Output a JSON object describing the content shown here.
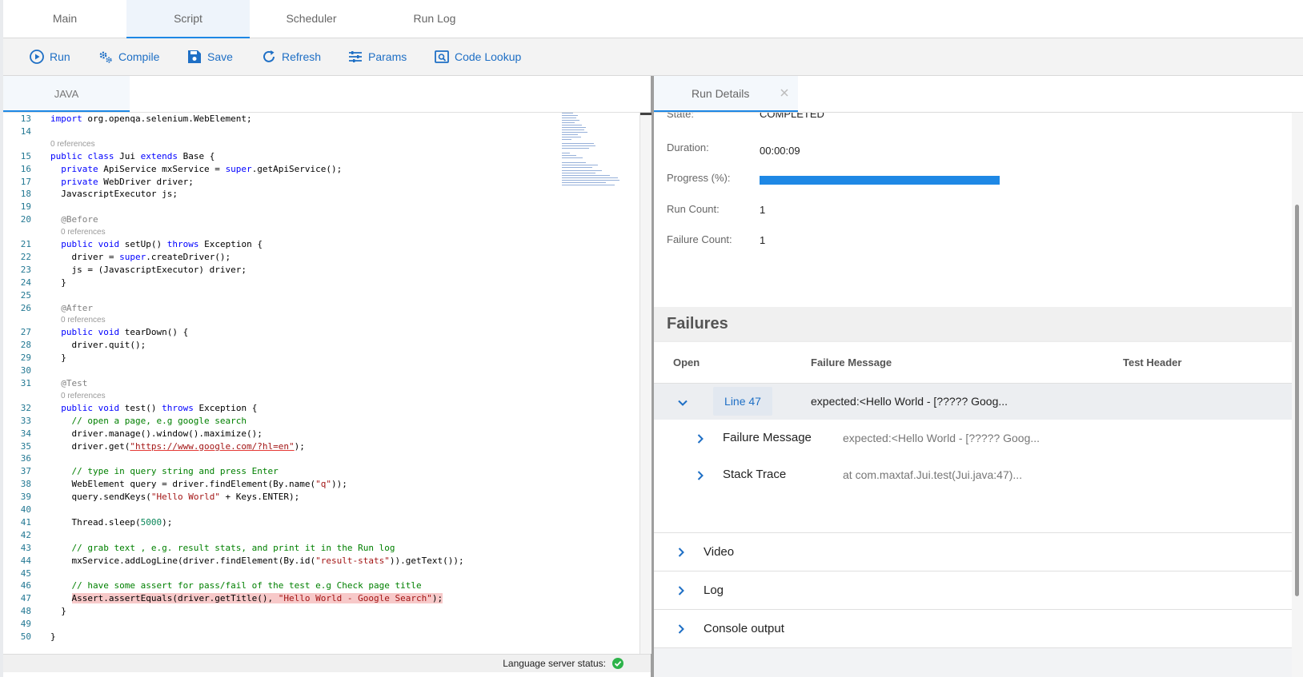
{
  "top_tabs": [
    "Main",
    "Script",
    "Scheduler",
    "Run Log"
  ],
  "active_top_tab": "Script",
  "toolbar": {
    "run": "Run",
    "compile": "Compile",
    "save": "Save",
    "refresh": "Refresh",
    "params": "Params",
    "code_lookup": "Code Lookup"
  },
  "colors": {
    "accent": "#1e88e5",
    "link": "#1e6fc5",
    "error_bg": "#f7c9c9",
    "ok": "#2db34a"
  },
  "editor": {
    "tab": "JAVA",
    "references_label": "0 references",
    "lines": [
      {
        "n": "13",
        "t": "import org.openqa.selenium.WebElement;"
      },
      {
        "n": "14",
        "t": ""
      },
      {
        "n": "15",
        "t": "public class Jui extends Base {"
      },
      {
        "n": "16",
        "t": "  private ApiService mxService = super.getApiService();"
      },
      {
        "n": "17",
        "t": "  private WebDriver driver;"
      },
      {
        "n": "18",
        "t": "  JavascriptExecutor js;"
      },
      {
        "n": "19",
        "t": ""
      },
      {
        "n": "20",
        "t": "  @Before"
      },
      {
        "n": "21",
        "t": "  public void setUp() throws Exception {"
      },
      {
        "n": "22",
        "t": "    driver = super.createDriver();"
      },
      {
        "n": "23",
        "t": "    js = (JavascriptExecutor) driver;"
      },
      {
        "n": "24",
        "t": "  }"
      },
      {
        "n": "25",
        "t": ""
      },
      {
        "n": "26",
        "t": "  @After"
      },
      {
        "n": "27",
        "t": "  public void tearDown() {"
      },
      {
        "n": "28",
        "t": "    driver.quit();"
      },
      {
        "n": "29",
        "t": "  }"
      },
      {
        "n": "30",
        "t": ""
      },
      {
        "n": "31",
        "t": "  @Test"
      },
      {
        "n": "32",
        "t": "  public void test() throws Exception {"
      },
      {
        "n": "33",
        "t": "    // open a page, e.g google search"
      },
      {
        "n": "34",
        "t": "    driver.manage().window().maximize();"
      },
      {
        "n": "35",
        "t": "    driver.get(\"https://www.google.com/?hl=en\");"
      },
      {
        "n": "36",
        "t": ""
      },
      {
        "n": "37",
        "t": "    // type in query string and press Enter"
      },
      {
        "n": "38",
        "t": "    WebElement query = driver.findElement(By.name(\"q\"));"
      },
      {
        "n": "39",
        "t": "    query.sendKeys(\"Hello World\" + Keys.ENTER);"
      },
      {
        "n": "40",
        "t": ""
      },
      {
        "n": "41",
        "t": "    Thread.sleep(5000);"
      },
      {
        "n": "42",
        "t": ""
      },
      {
        "n": "43",
        "t": "    // grab text , e.g. result stats, and print it in the Run log"
      },
      {
        "n": "44",
        "t": "    mxService.addLogLine(driver.findElement(By.id(\"result-stats\")).getText());"
      },
      {
        "n": "45",
        "t": ""
      },
      {
        "n": "46",
        "t": "    // have some assert for pass/fail of the test e.g Check page title"
      },
      {
        "n": "47",
        "t": "    Assert.assertEquals(driver.getTitle(), \"Hello World - Google Search\");"
      },
      {
        "n": "48",
        "t": "  }"
      },
      {
        "n": "49",
        "t": ""
      },
      {
        "n": "50",
        "t": "}"
      }
    ],
    "status_label": "Language server status:"
  },
  "run_details": {
    "tab": "Run Details",
    "state_label": "State:",
    "state_value": "COMPLETED",
    "duration_label": "Duration:",
    "duration_value": "00:00:09",
    "progress_label": "Progress (%):",
    "progress_percent": 100,
    "run_count_label": "Run Count:",
    "run_count_value": "1",
    "failure_count_label": "Failure Count:",
    "failure_count_value": "1"
  },
  "failures": {
    "title": "Failures",
    "col_open": "Open",
    "col_message": "Failure Message",
    "col_header": "Test Header",
    "row": {
      "line": "Line 47",
      "message": "expected:<Hello World - [????? Goog..."
    },
    "sub_rows": [
      {
        "label": "Failure Message",
        "value": "expected:<Hello World - [????? Goog..."
      },
      {
        "label": "Stack Trace",
        "value": "at com.maxtaf.Jui.test(Jui.java:47)..."
      }
    ]
  },
  "panels": [
    "Video",
    "Log",
    "Console output"
  ]
}
